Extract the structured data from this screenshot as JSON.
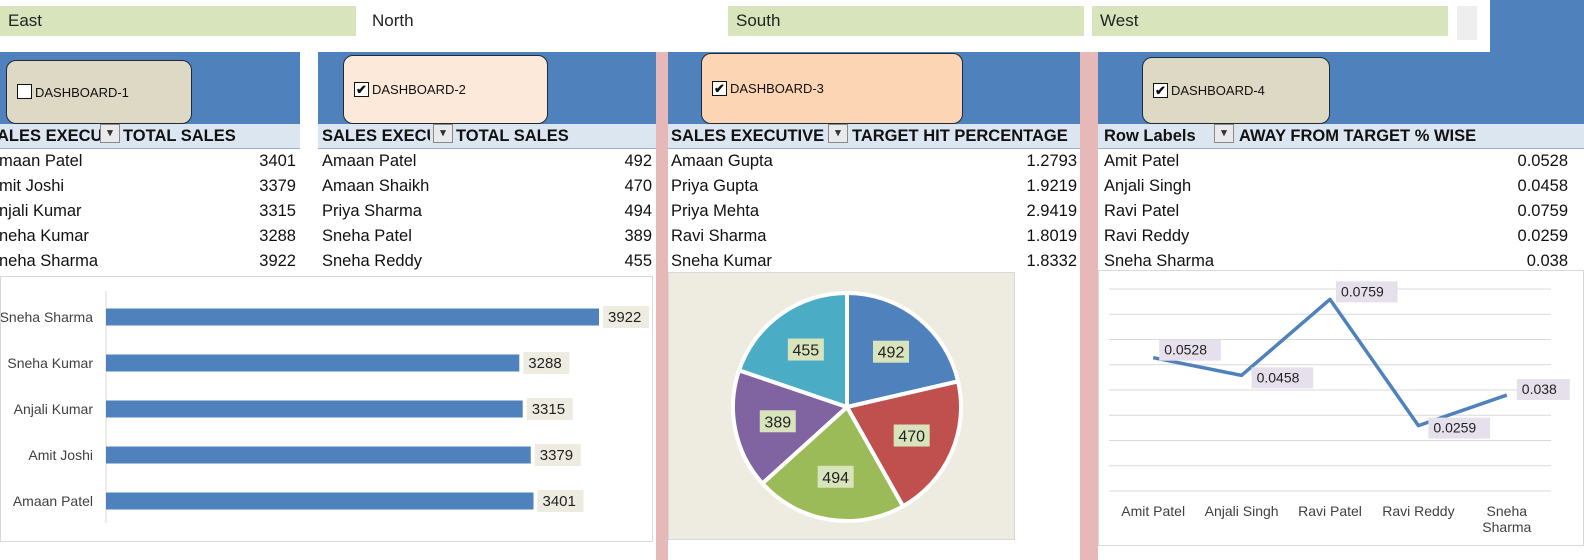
{
  "slicers": [
    "East",
    "North",
    "South",
    "West"
  ],
  "slicer_selected": [
    true,
    false,
    true,
    true
  ],
  "buttons": [
    {
      "label": "DASHBOARD-1",
      "checked": false,
      "color": "#ddd9c4"
    },
    {
      "label": "DASHBOARD-2",
      "checked": true,
      "color": "#fde9d9"
    },
    {
      "label": "DASHBOARD-3",
      "checked": true,
      "color": "#fcd5b4"
    },
    {
      "label": "DASHBOARD-4",
      "checked": true,
      "color": "#ddd9c4"
    }
  ],
  "check_glyph": "✔",
  "filter_icon": "funnel-filter-icon",
  "pivots": [
    {
      "col1": "SALES EXECUTIVE",
      "col2": "TOTAL SALES",
      "rows": [
        {
          "name": "Amaan Patel",
          "value": "3401"
        },
        {
          "name": "Amit Joshi",
          "value": "3379"
        },
        {
          "name": "Anjali Kumar",
          "value": "3315"
        },
        {
          "name": "Sneha Kumar",
          "value": "3288"
        },
        {
          "name": "Sneha Sharma",
          "value": "3922"
        }
      ]
    },
    {
      "col1": "SALES EXECUTIVE",
      "col2": "TOTAL SALES",
      "rows": [
        {
          "name": "Amaan Patel",
          "value": "492"
        },
        {
          "name": "Amaan Shaikh",
          "value": "470"
        },
        {
          "name": "Priya Sharma",
          "value": "494"
        },
        {
          "name": "Sneha Patel",
          "value": "389"
        },
        {
          "name": "Sneha Reddy",
          "value": "455"
        }
      ]
    },
    {
      "col1": "SALES EXECUTIVE",
      "col2": "TARGET HIT PERCENTAGE",
      "rows": [
        {
          "name": "Amaan Gupta",
          "value": "1.2793"
        },
        {
          "name": "Priya Gupta",
          "value": "1.9219"
        },
        {
          "name": "Priya Mehta",
          "value": "2.9419"
        },
        {
          "name": "Ravi Sharma",
          "value": "1.8019"
        },
        {
          "name": "Sneha Kumar",
          "value": "1.8332"
        }
      ]
    },
    {
      "col1": "Row Labels",
      "col2": "AWAY FROM TARGET % WISE",
      "rows": [
        {
          "name": "Amit Patel",
          "value": "0.0528"
        },
        {
          "name": "Anjali Singh",
          "value": "0.0458"
        },
        {
          "name": "Ravi Patel",
          "value": "0.0759"
        },
        {
          "name": "Ravi Reddy",
          "value": "0.0259"
        },
        {
          "name": "Sneha Sharma",
          "value": "0.038"
        }
      ]
    }
  ],
  "chart_data": [
    {
      "type": "bar",
      "orientation": "horizontal",
      "categories": [
        "Sneha Sharma",
        "Sneha Kumar",
        "Anjali Kumar",
        "Amit Joshi",
        "Amaan Patel"
      ],
      "values": [
        3922,
        3288,
        3315,
        3379,
        3401
      ],
      "xlim": [
        0,
        4000
      ],
      "color": "#4f81bd",
      "data_labels": true
    },
    {
      "type": "pie",
      "values": [
        492,
        470,
        494,
        389,
        455
      ],
      "colors": [
        "#4f81bd",
        "#c0504d",
        "#9bbb59",
        "#8064a2",
        "#4bacc6"
      ],
      "data_labels": true
    },
    {
      "type": "line",
      "categories": [
        "Amit Patel",
        "Anjali Singh",
        "Ravi Patel",
        "Ravi Reddy",
        "Sneha Sharma"
      ],
      "category_lines": [
        [
          "Amit Patel"
        ],
        [
          "Anjali Singh"
        ],
        [
          "Ravi Patel"
        ],
        [
          "Ravi Reddy"
        ],
        [
          "Sneha",
          "Sharma"
        ]
      ],
      "values": [
        0.0528,
        0.0458,
        0.0759,
        0.0259,
        0.038
      ],
      "labels": [
        "0.0528",
        "0.0458",
        "0.0759",
        "0.0259",
        "0.038"
      ],
      "ylim": [
        0,
        0.08
      ],
      "grid": true,
      "color": "#4f81bd"
    }
  ]
}
